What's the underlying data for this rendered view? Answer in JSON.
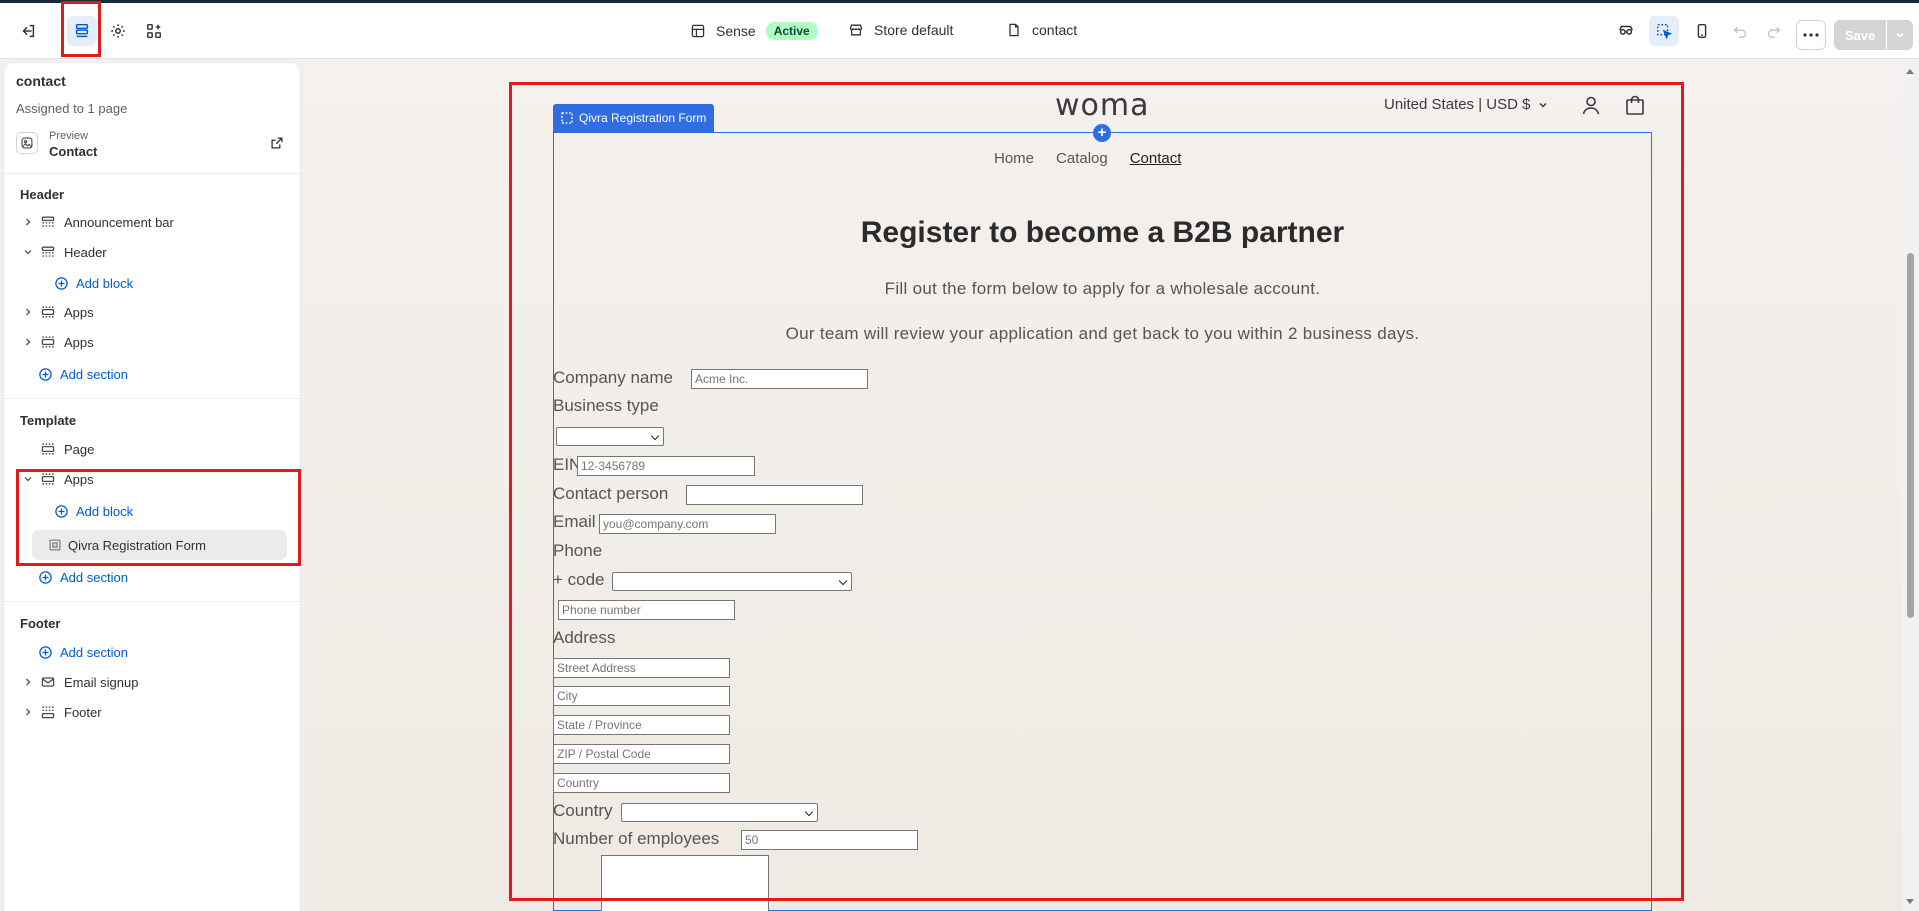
{
  "topbar": {
    "theme_name": "Sense",
    "theme_status": "Active",
    "store_label": "Store default",
    "page_label": "contact",
    "save_label": "Save"
  },
  "sidebar": {
    "title": "contact",
    "assigned": "Assigned to 1 page",
    "preview_label": "Preview",
    "preview_value": "Contact",
    "header_heading": "Header",
    "header_items": [
      "Announcement bar",
      "Header",
      "Apps",
      "Apps"
    ],
    "add_block": "Add block",
    "add_section": "Add section",
    "template_heading": "Template",
    "template_items": [
      "Page",
      "Apps"
    ],
    "app_block": "Qivra Registration Form",
    "footer_heading": "Footer",
    "footer_items": [
      "Email signup",
      "Footer"
    ]
  },
  "store": {
    "logo": "woma",
    "currency": "United States | USD $",
    "nav": [
      "Home",
      "Catalog",
      "Contact"
    ]
  },
  "section_tag": "Qivra Registration Form",
  "form": {
    "title": "Register to become a B2B partner",
    "intro1": "Fill out the form below to apply for a wholesale account.",
    "intro2": "Our team will review your application and get back to you within 2 business days.",
    "company_label": "Company name",
    "company_placeholder": "Acme Inc.",
    "business_type_label": "Business type",
    "ein_label": "EIN",
    "ein_placeholder": "12-3456789",
    "contact_label": "Contact person",
    "email_label": "Email",
    "email_placeholder": "you@company.com",
    "phone_label": "Phone",
    "code_label": "+ code",
    "phone_placeholder": "Phone number",
    "address_label": "Address",
    "street_placeholder": "Street Address",
    "city_placeholder": "City",
    "state_placeholder": "State / Province",
    "zip_placeholder": "ZIP / Postal Code",
    "country_placeholder": "Country",
    "country_label": "Country",
    "employees_label": "Number of employees",
    "employees_placeholder": "50"
  }
}
